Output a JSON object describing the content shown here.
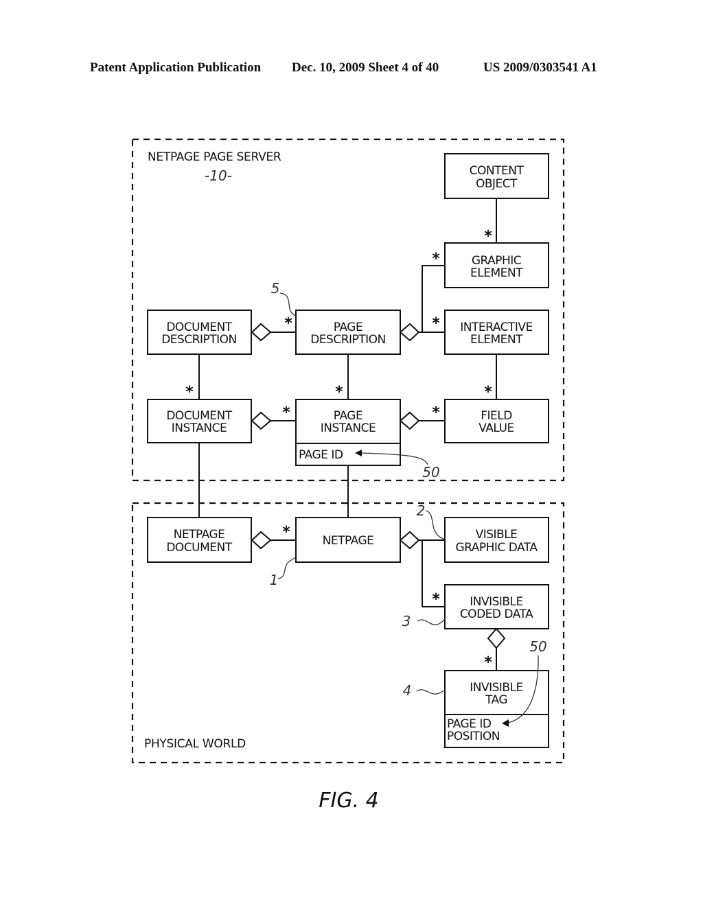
{
  "header": {
    "publication": "Patent Application Publication",
    "date_sheet": "Dec. 10, 2009   Sheet 4 of 40",
    "patent_number": "US 2009/0303541 A1"
  },
  "regions": {
    "server": {
      "label": "NETPAGE PAGE SERVER",
      "ref": "-10-"
    },
    "physical": {
      "label": "PHYSICAL WORLD"
    }
  },
  "boxes": {
    "content_object": {
      "lines": [
        "CONTENT",
        "OBJECT"
      ]
    },
    "graphic_element": {
      "lines": [
        "GRAPHIC",
        "ELEMENT"
      ]
    },
    "document_description": {
      "lines": [
        "DOCUMENT",
        "DESCRIPTION"
      ]
    },
    "page_description": {
      "lines": [
        "PAGE",
        "DESCRIPTION"
      ]
    },
    "interactive_element": {
      "lines": [
        "INTERACTIVE",
        "ELEMENT"
      ]
    },
    "document_instance": {
      "lines": [
        "DOCUMENT",
        "INSTANCE"
      ]
    },
    "page_instance": {
      "lines": [
        "PAGE",
        "INSTANCE"
      ],
      "attributes": [
        "PAGE ID"
      ]
    },
    "field_value": {
      "lines": [
        "FIELD",
        "VALUE"
      ]
    },
    "netpage_document": {
      "lines": [
        "NETPAGE",
        "DOCUMENT"
      ]
    },
    "netpage": {
      "lines": [
        "NETPAGE"
      ]
    },
    "visible_graphic_data": {
      "lines": [
        "VISIBLE",
        "GRAPHIC DATA"
      ]
    },
    "invisible_coded_data": {
      "lines": [
        "INVISIBLE",
        "CODED DATA"
      ]
    },
    "invisible_tag": {
      "lines": [
        "INVISIBLE",
        "TAG"
      ],
      "attributes": [
        "PAGE ID",
        "POSITION"
      ]
    }
  },
  "multiplicity": "*",
  "refs": {
    "page_description": "5",
    "page_id_server": "50",
    "netpage": "1",
    "visible_graphic_data": "2",
    "invisible_coded_data": "3",
    "invisible_tag": "4",
    "page_id_tag": "50"
  },
  "caption": "FIG. 4"
}
